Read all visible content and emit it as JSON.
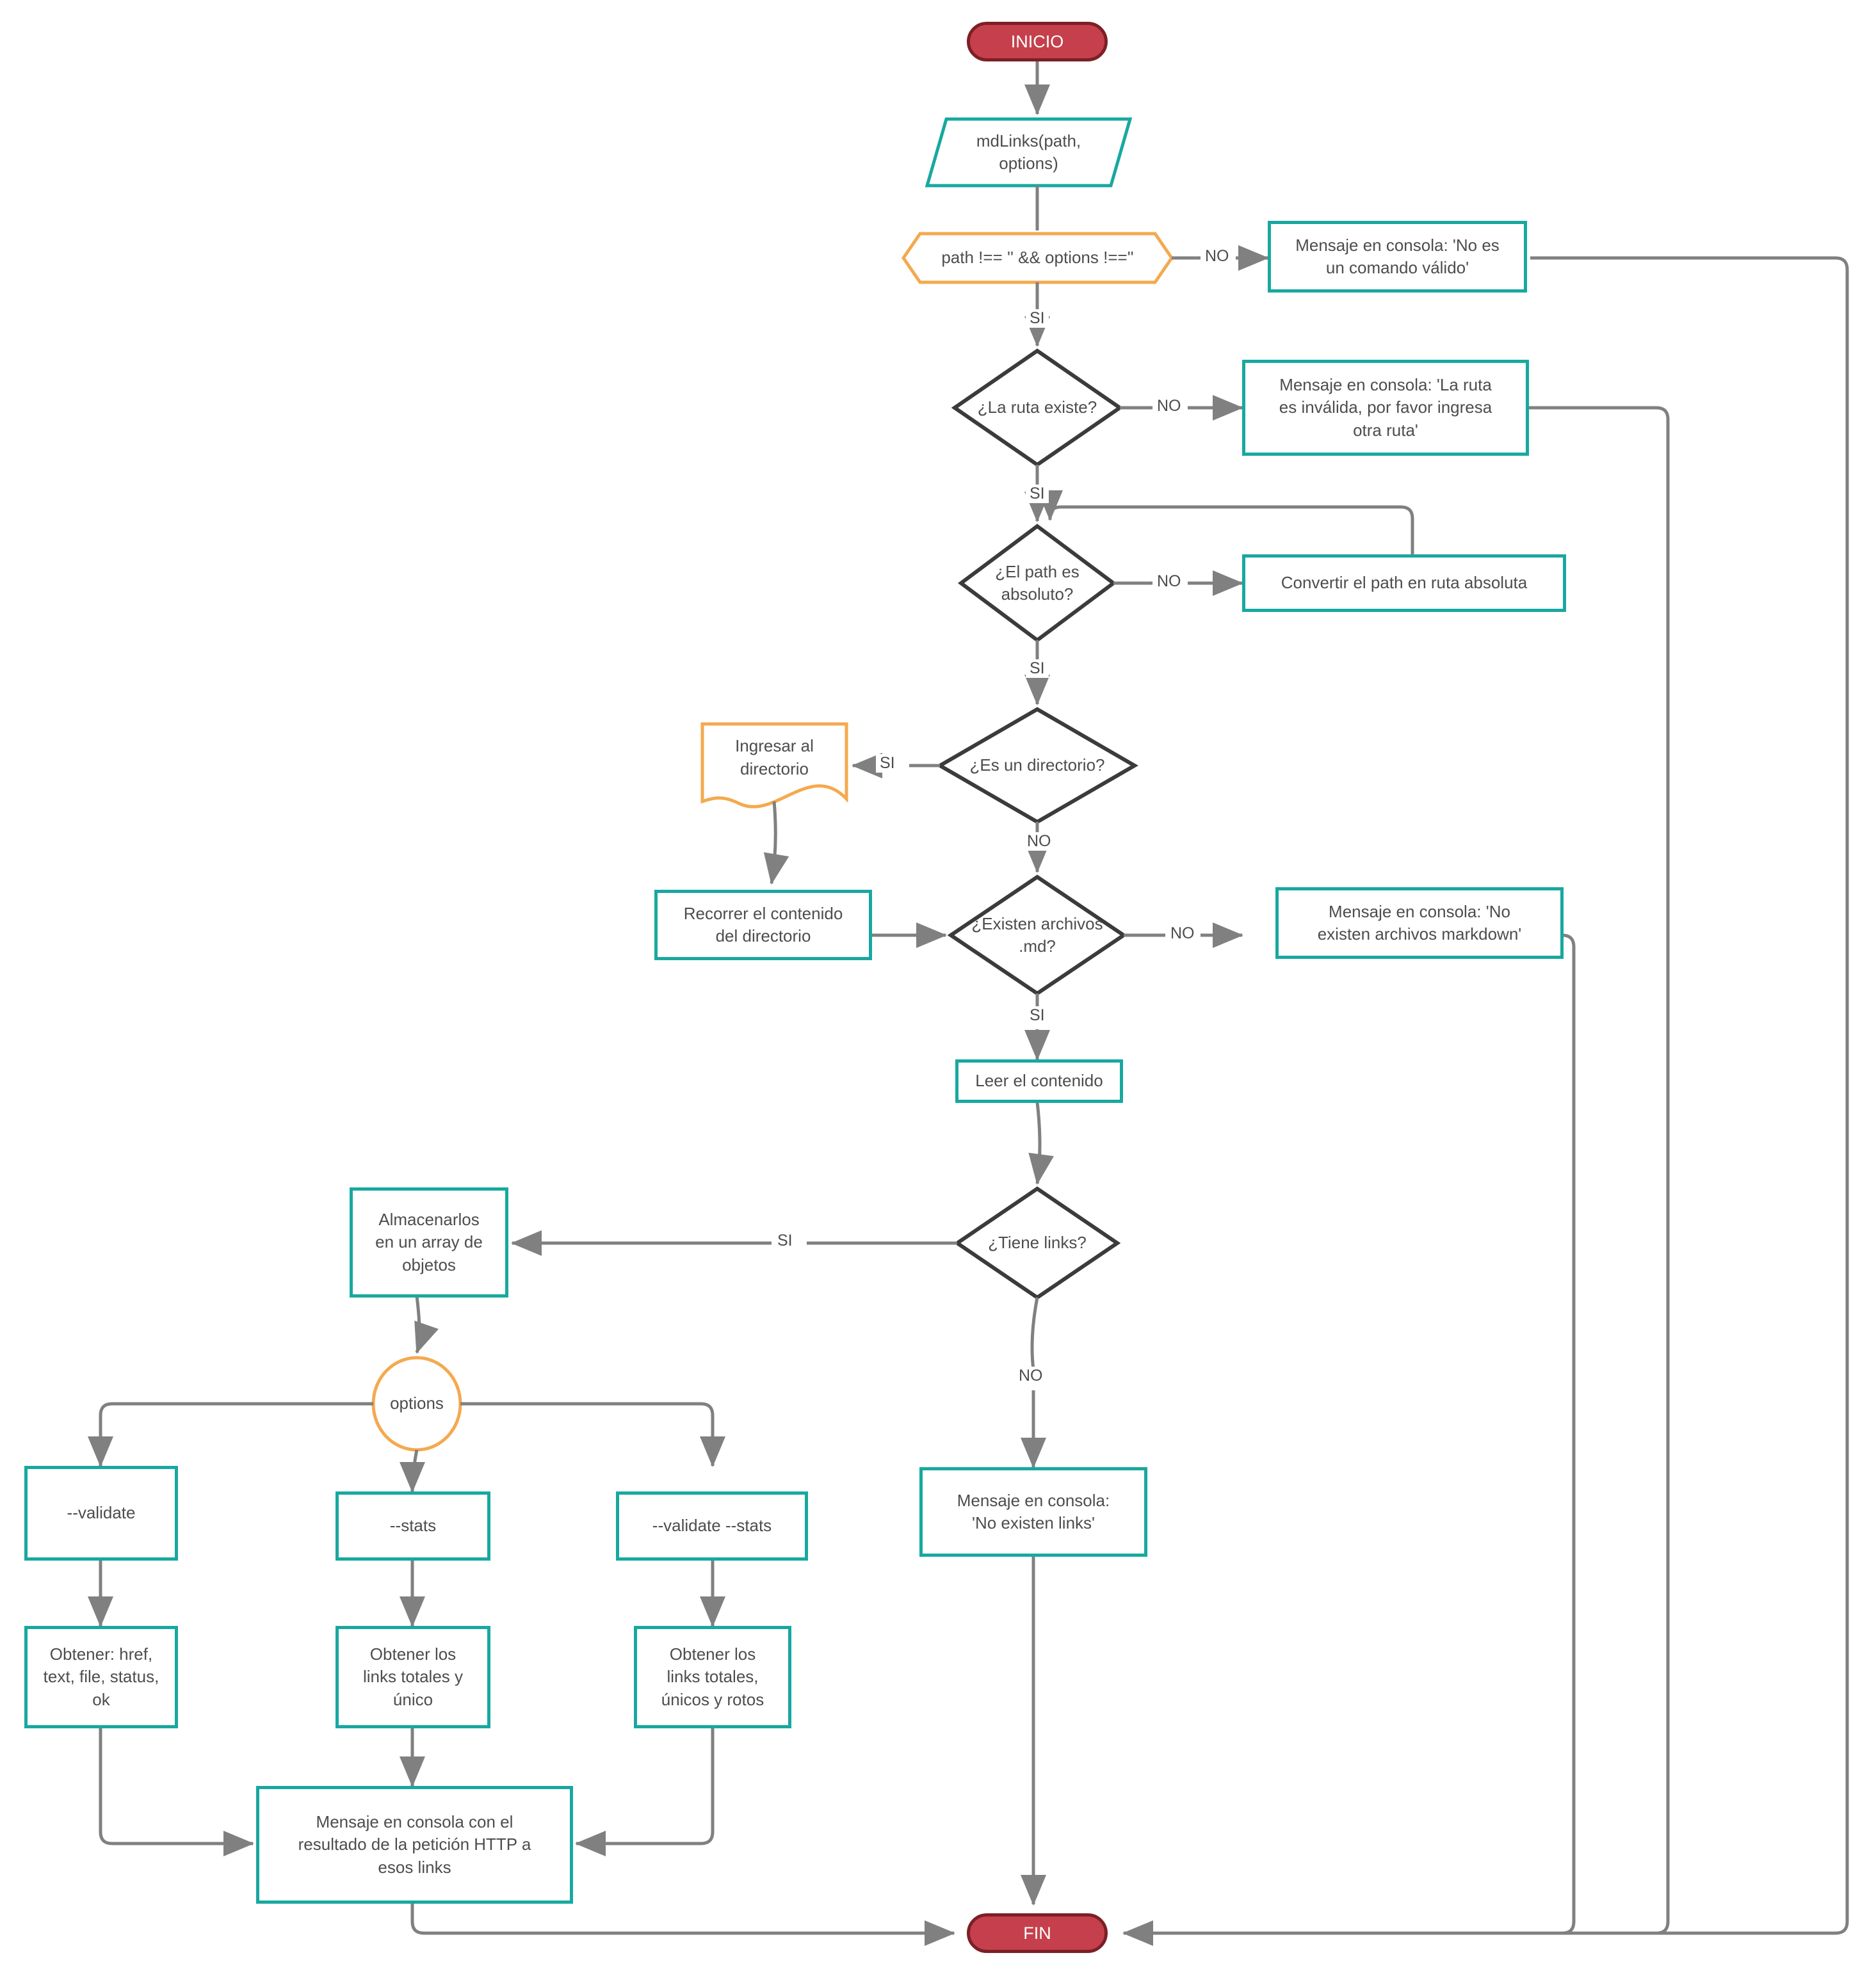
{
  "diagram": {
    "title_text": "",
    "colors": {
      "process_border": "#18a8a0",
      "decision_border": "#3b3b3b",
      "terminator_fill": "#c5404c",
      "terminator_border": "#7d1f26",
      "accent_orange": "#f4a94f",
      "connector": "#808080",
      "text": "#4d4d4d"
    }
  },
  "nodes": {
    "inicio": {
      "label": "INICIO",
      "shape": "terminator"
    },
    "mdlinks": {
      "label": "mdLinks(path,\noptions)",
      "shape": "parallelogram"
    },
    "cond_path_options": {
      "label": "path !== '' && options !==''",
      "shape": "hexagon"
    },
    "msg_no_comando": {
      "label": "Mensaje en consola: 'No es\nun comando válido'",
      "shape": "process"
    },
    "dec_ruta_existe": {
      "label": "¿La ruta existe?",
      "shape": "decision"
    },
    "msg_ruta_invalida": {
      "label": "Mensaje en consola: 'La ruta\nes inválida, por favor ingresa\notra ruta'",
      "shape": "process"
    },
    "dec_path_absoluto": {
      "label": "¿El path es\nabsoluto?",
      "shape": "decision"
    },
    "convertir_path": {
      "label": "Convertir el path en ruta absoluta",
      "shape": "process"
    },
    "dec_es_directorio": {
      "label": "¿Es un directorio?",
      "shape": "decision"
    },
    "ingresar_directorio": {
      "label": "Ingresar al\ndirectorio",
      "shape": "document"
    },
    "recorrer_directorio": {
      "label": "Recorrer el contenido\ndel directorio",
      "shape": "process"
    },
    "dec_existen_md": {
      "label": "¿Existen archivos\n.md?",
      "shape": "decision"
    },
    "msg_no_markdown": {
      "label": "Mensaje en consola: 'No\nexisten archivos markdown'",
      "shape": "process"
    },
    "leer_contenido": {
      "label": "Leer el contenido",
      "shape": "process"
    },
    "dec_tiene_links": {
      "label": "¿Tiene links?",
      "shape": "decision"
    },
    "almacenarlos": {
      "label": "Almacenarlos\nen un array de\nobjetos",
      "shape": "process"
    },
    "msg_no_links": {
      "label": "Mensaje en consola:\n'No existen links'",
      "shape": "process"
    },
    "options": {
      "label": "options",
      "shape": "circle"
    },
    "opt_validate": {
      "label": "--validate",
      "shape": "process"
    },
    "opt_stats": {
      "label": "--stats",
      "shape": "process"
    },
    "opt_validate_stats": {
      "label": "--validate --stats",
      "shape": "process"
    },
    "obtener_href": {
      "label": "Obtener: href,\ntext, file, status,\nok",
      "shape": "process"
    },
    "obtener_totales_unico": {
      "label": "Obtener los\nlinks totales y\núnico",
      "shape": "process"
    },
    "obtener_totales_rotos": {
      "label": "Obtener los\nlinks totales,\núnicos y rotos",
      "shape": "process"
    },
    "msg_http": {
      "label": "Mensaje en consola con el\nresultado de la petición HTTP a\nesos links",
      "shape": "process"
    },
    "fin": {
      "label": "FIN",
      "shape": "terminator"
    }
  },
  "edge_labels": {
    "no1": "NO",
    "si1": "SI",
    "no2": "NO",
    "si2": "SI",
    "no3": "NO",
    "si3": "SI",
    "si_dir": "SI",
    "no_dir": "NO",
    "no_md": "NO",
    "si_md": "SI",
    "si_links": "SI",
    "no_links": "NO"
  },
  "chart_data": {
    "type": "diagram",
    "flow": [
      {
        "from": "inicio",
        "to": "mdlinks",
        "label": ""
      },
      {
        "from": "mdlinks",
        "to": "cond_path_options",
        "label": ""
      },
      {
        "from": "cond_path_options",
        "to": "msg_no_comando",
        "label": "NO"
      },
      {
        "from": "cond_path_options",
        "to": "dec_ruta_existe",
        "label": "SI"
      },
      {
        "from": "msg_no_comando",
        "to": "fin",
        "label": ""
      },
      {
        "from": "dec_ruta_existe",
        "to": "msg_ruta_invalida",
        "label": "NO"
      },
      {
        "from": "dec_ruta_existe",
        "to": "dec_path_absoluto",
        "label": "SI"
      },
      {
        "from": "msg_ruta_invalida",
        "to": "fin",
        "label": ""
      },
      {
        "from": "dec_path_absoluto",
        "to": "convertir_path",
        "label": "NO"
      },
      {
        "from": "convertir_path",
        "to": "dec_path_absoluto",
        "label": ""
      },
      {
        "from": "dec_path_absoluto",
        "to": "dec_es_directorio",
        "label": "SI"
      },
      {
        "from": "dec_es_directorio",
        "to": "ingresar_directorio",
        "label": "SI"
      },
      {
        "from": "dec_es_directorio",
        "to": "dec_existen_md",
        "label": "NO"
      },
      {
        "from": "ingresar_directorio",
        "to": "recorrer_directorio",
        "label": ""
      },
      {
        "from": "recorrer_directorio",
        "to": "dec_existen_md",
        "label": ""
      },
      {
        "from": "dec_existen_md",
        "to": "msg_no_markdown",
        "label": "NO"
      },
      {
        "from": "dec_existen_md",
        "to": "leer_contenido",
        "label": "SI"
      },
      {
        "from": "msg_no_markdown",
        "to": "fin",
        "label": ""
      },
      {
        "from": "leer_contenido",
        "to": "dec_tiene_links",
        "label": ""
      },
      {
        "from": "dec_tiene_links",
        "to": "almacenarlos",
        "label": "SI"
      },
      {
        "from": "dec_tiene_links",
        "to": "msg_no_links",
        "label": "NO"
      },
      {
        "from": "msg_no_links",
        "to": "fin",
        "label": ""
      },
      {
        "from": "almacenarlos",
        "to": "options",
        "label": ""
      },
      {
        "from": "options",
        "to": "opt_validate",
        "label": ""
      },
      {
        "from": "options",
        "to": "opt_stats",
        "label": ""
      },
      {
        "from": "options",
        "to": "opt_validate_stats",
        "label": ""
      },
      {
        "from": "opt_validate",
        "to": "obtener_href",
        "label": ""
      },
      {
        "from": "opt_stats",
        "to": "obtener_totales_unico",
        "label": ""
      },
      {
        "from": "opt_validate_stats",
        "to": "obtener_totales_rotos",
        "label": ""
      },
      {
        "from": "obtener_href",
        "to": "msg_http",
        "label": ""
      },
      {
        "from": "obtener_totales_unico",
        "to": "msg_http",
        "label": ""
      },
      {
        "from": "obtener_totales_rotos",
        "to": "msg_http",
        "label": ""
      },
      {
        "from": "msg_http",
        "to": "fin",
        "label": ""
      }
    ]
  }
}
